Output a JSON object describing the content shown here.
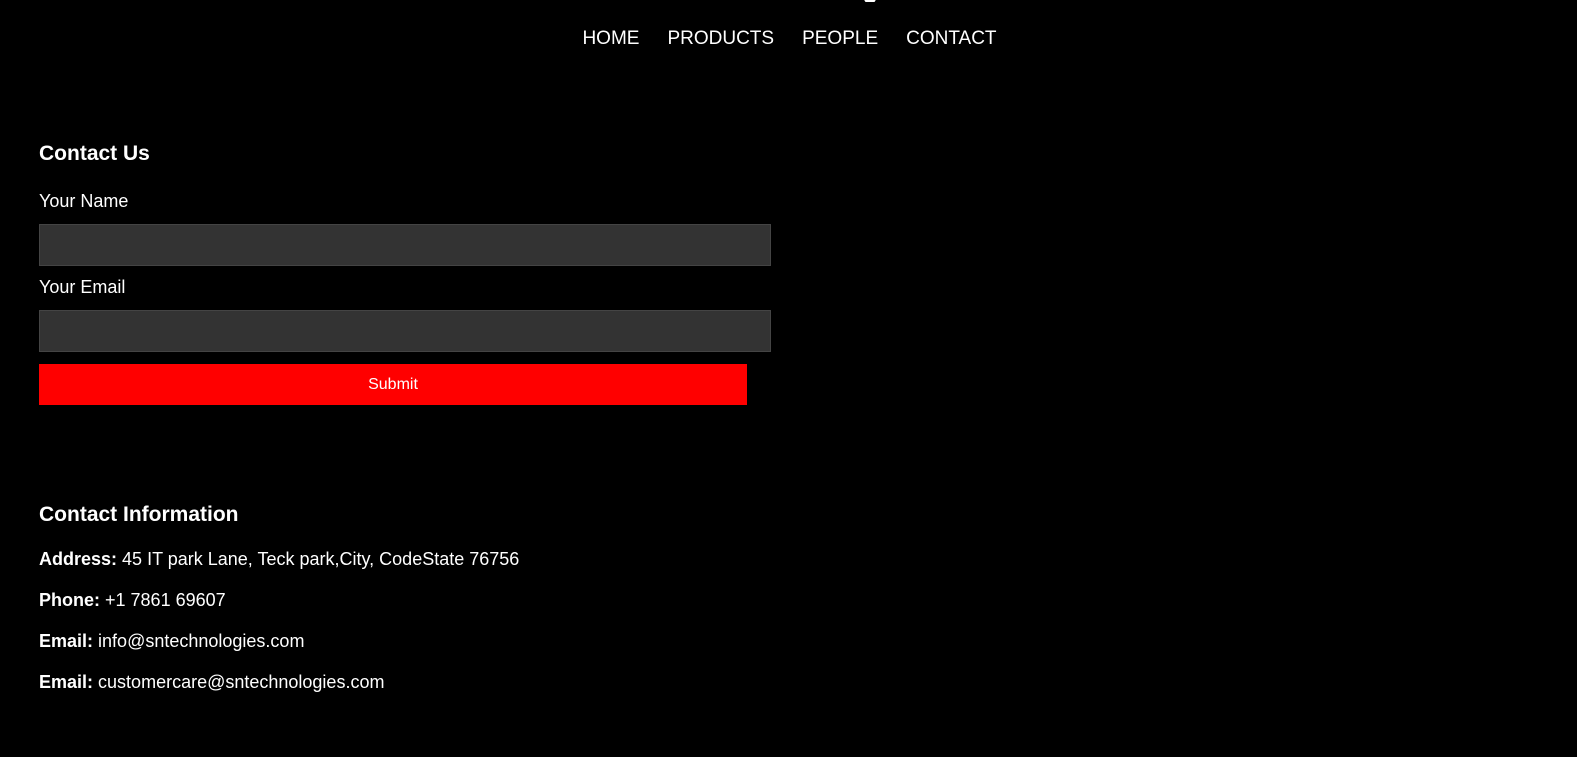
{
  "nav": {
    "items": [
      "HOME",
      "PRODUCTS",
      "PEOPLE",
      "CONTACT"
    ]
  },
  "contact_form": {
    "title": "Contact Us",
    "name_label": "Your Name",
    "name_value": "",
    "email_label": "Your Email",
    "email_value": "",
    "submit_label": "Submit"
  },
  "contact_info": {
    "title": "Contact Information",
    "address_label": "Address:",
    "address_value": "45 IT park Lane, Teck park,City, CodeState 76756",
    "phone_label": "Phone:",
    "phone_value": "+1 7861 69607",
    "email_label": "Email:",
    "email_value": "info@sntechnologies.com",
    "email2_label": "Email:",
    "email2_value": "customercare@sntechnologies.com"
  },
  "colors": {
    "background": "#000000",
    "text": "#ffffff",
    "input_bg": "#333333",
    "button_bg": "#ff0000"
  }
}
